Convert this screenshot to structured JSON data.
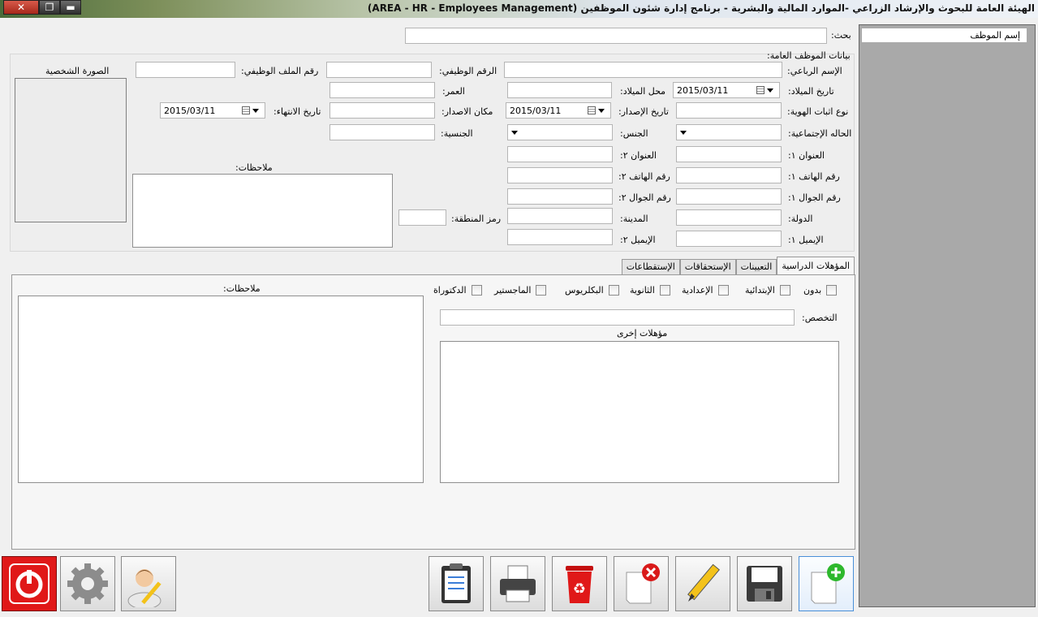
{
  "window": {
    "title": "الهيئة العامة للبحوث والإرشاد الزراعي -الموارد المالية والبشرية - برنامج إدارة شئون الموظفين (AREA - HR - Employees Management)",
    "close_glyph": "✕",
    "max_glyph": "❐",
    "min_glyph": "▬"
  },
  "sidebar": {
    "header": "إسم الموظف"
  },
  "search": {
    "label": "بحث:",
    "value": ""
  },
  "general": {
    "section_title": "بيانات الموظف العامة:",
    "photo_label": "الصورة الشخصية",
    "notes_label": "ملاحظات:",
    "fields": {
      "full_name": "الإسم الرباعي:",
      "job_number": "الرقم الوظيفي:",
      "file_number": "رقم الملف الوظيفي:",
      "birth_date": "تاريخ الميلاد:",
      "birth_place": "محل الميلاد:",
      "age": "العمر:",
      "id_type": "نوع اثبات الهوية:",
      "issue_date": "تاريخ الإصدار:",
      "issue_place": "مكان الاصدار:",
      "expiry_date": "تاريخ الانتهاء:",
      "marital_status": "الحاله الإجتماعية:",
      "gender": "الجنس:",
      "nationality": "الجنسية:",
      "address1": "العنوان ١:",
      "address2": "العنوان ٢:",
      "phone1": "رقم الهاتف ١:",
      "phone2": "رقم الهاتف ٢:",
      "mobile1": "رقم الجوال ١:",
      "mobile2": "رقم الجوال ٢:",
      "country": "الدولة:",
      "city": "المدينة:",
      "area_code": "رمز المنطقة:",
      "email1": "الإيميل ١:",
      "email2": "الإيميل ٢:"
    },
    "values": {
      "birth_date": "2015/03/11",
      "issue_date": "2015/03/11",
      "expiry_date": "2015/03/11"
    }
  },
  "tabs": [
    {
      "label": "المؤهلات الدراسية",
      "active": true
    },
    {
      "label": "التعيينات",
      "active": false
    },
    {
      "label": "الإستحقاقات",
      "active": false
    },
    {
      "label": "الإستقطاعات",
      "active": false
    }
  ],
  "qualifications": {
    "levels": [
      "بدون",
      "الإبتدائية",
      "الإعدادية",
      "الثانوية",
      "البكلريوس",
      "الماجستير",
      "الدكتوراة"
    ],
    "specialization_label": "التخصص:",
    "other_label": "مؤهلات إخرى",
    "notes_label": "ملاحظات:"
  },
  "toolbar": {
    "icons": [
      "new-icon",
      "save-icon",
      "edit-icon",
      "cancel-icon",
      "delete-icon",
      "print-icon",
      "report-icon",
      "user-icon",
      "settings-icon",
      "power-icon"
    ]
  }
}
